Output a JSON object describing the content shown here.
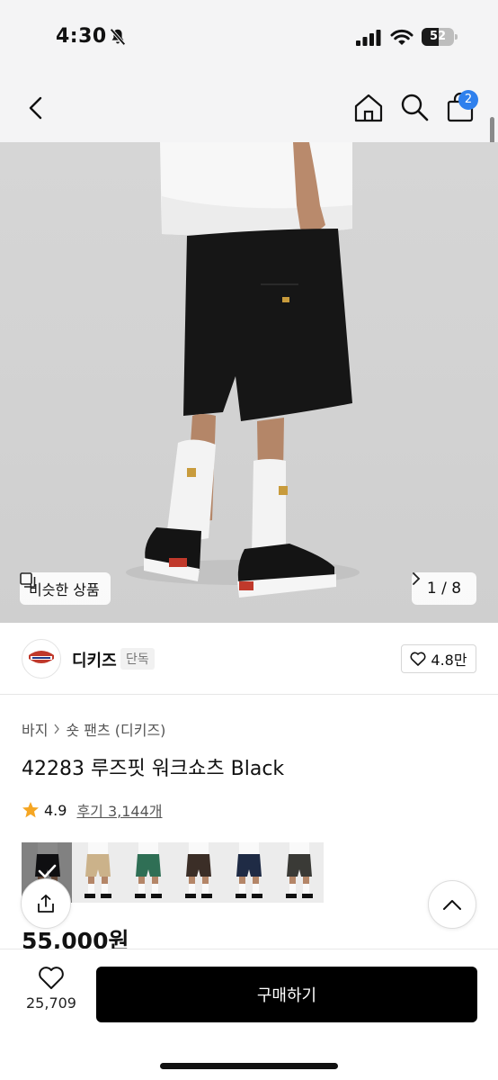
{
  "status_bar": {
    "time": "4:30",
    "battery": "52",
    "battery_level": 0.52
  },
  "header": {
    "cart_badge": "2"
  },
  "hero": {
    "similar_label": "비슷한 상품",
    "page_indicator": "1 / 8"
  },
  "brand": {
    "name": "디키즈",
    "tag": "단독",
    "likes": "4.8만"
  },
  "product": {
    "breadcrumb": [
      "바지",
      "숏 팬츠 (디키즈)"
    ],
    "title": "42283 루즈핏 워크쇼츠 Black",
    "rating": "4.9",
    "reviews": "후기 3,144개",
    "price": "55,000원",
    "swatches": [
      {
        "color": "#1d1d1f",
        "selected": true
      },
      {
        "color": "#cbb28a",
        "selected": false
      },
      {
        "color": "#2f6f55",
        "selected": false
      },
      {
        "color": "#3b2e27",
        "selected": false
      },
      {
        "color": "#1f2b45",
        "selected": false
      },
      {
        "color": "#3a3a36",
        "selected": false
      }
    ]
  },
  "bottom_bar": {
    "wish_count": "25,709",
    "buy_label": "구매하기"
  },
  "colors": {
    "accent_blue": "#2f80ed",
    "star": "#f5a623",
    "buy_button": "#000000"
  }
}
